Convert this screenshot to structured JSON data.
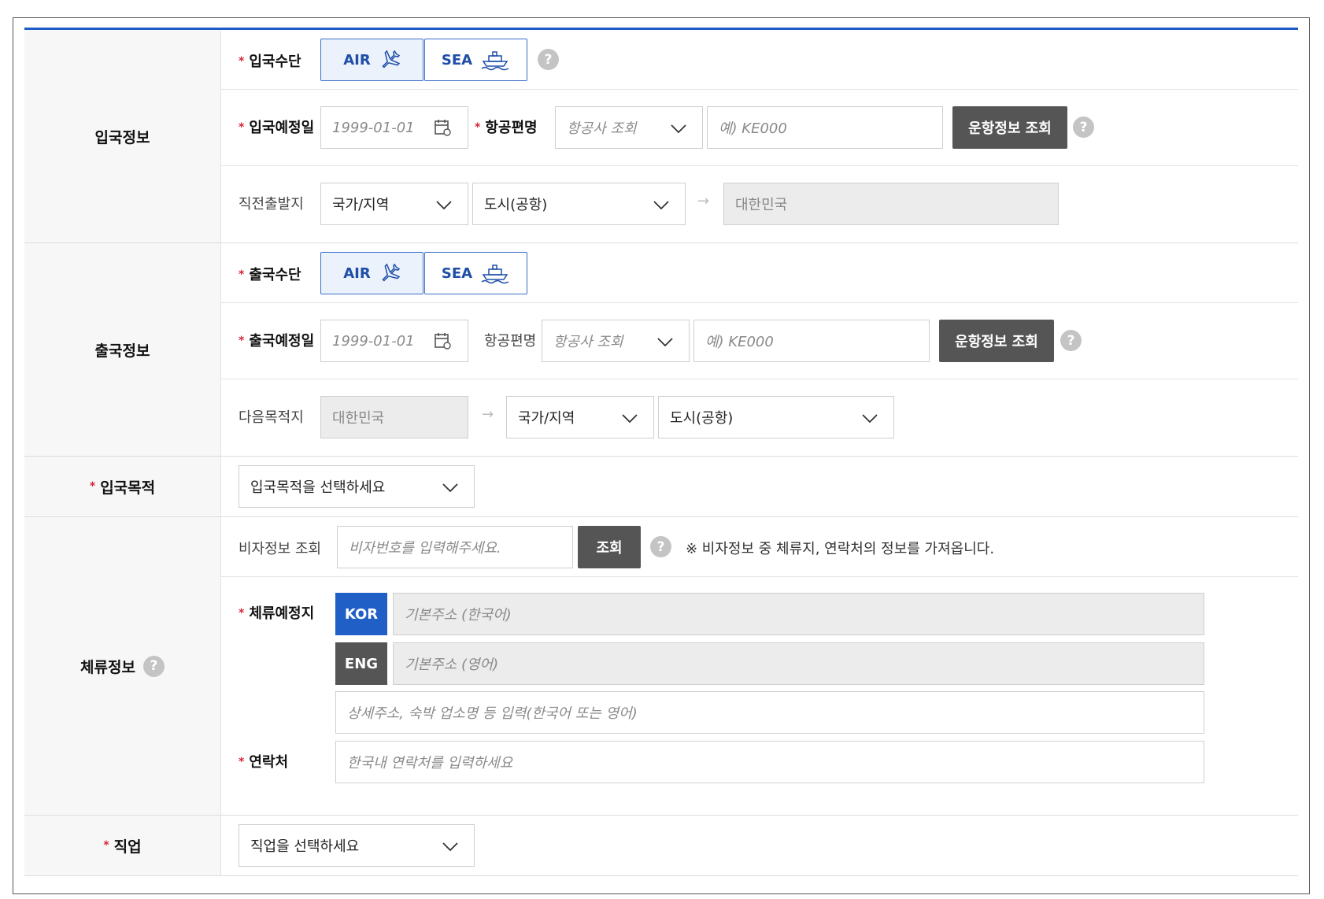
{
  "entry": {
    "section_label": "입국정보",
    "mode_label": "입국수단",
    "air": "AIR",
    "sea": "SEA",
    "date_label": "입국예정일",
    "date_value": "1999-01-01",
    "flight_label": "항공편명",
    "airline_placeholder": "항공사 조회",
    "flight_placeholder": "예) KE000",
    "lookup_button": "운항정보 조회",
    "origin_label": "직전출발지",
    "country_placeholder": "국가/지역",
    "city_placeholder": "도시(공항)",
    "destination_fixed": "대한민국"
  },
  "exit": {
    "section_label": "출국정보",
    "mode_label": "출국수단",
    "air": "AIR",
    "sea": "SEA",
    "date_label": "출국예정일",
    "date_value": "1999-01-01",
    "flight_label": "항공편명",
    "airline_placeholder": "항공사 조회",
    "flight_placeholder": "예) KE000",
    "lookup_button": "운항정보 조회",
    "next_label": "다음목적지",
    "origin_fixed": "대한민국",
    "country_placeholder": "국가/지역",
    "city_placeholder": "도시(공항)"
  },
  "purpose": {
    "label": "입국목적",
    "placeholder": "입국목적을 선택하세요"
  },
  "stay": {
    "section_label": "체류정보",
    "visa_label": "비자정보 조회",
    "visa_placeholder": "비자번호를 입력해주세요.",
    "visa_button": "조회",
    "visa_note": "※ 비자정보 중 체류지, 연락처의 정보를 가져옵니다.",
    "address_label": "체류예정지",
    "kor": "KOR",
    "eng": "ENG",
    "addr_kor_placeholder": "기본주소 (한국어)",
    "addr_eng_placeholder": "기본주소 (영어)",
    "addr_detail_placeholder": "상세주소, 숙박 업소명 등 입력(한국어 또는 영어)",
    "contact_label": "연락처",
    "contact_placeholder": "한국내 연락처를 입력하세요"
  },
  "job": {
    "label": "직업",
    "placeholder": "직업을 선택하세요"
  },
  "help_glyph": "?",
  "required_mark": "*",
  "arrow_glyph": "→",
  "colors": {
    "accent_blue": "#1e5bc6",
    "required_red": "#d6263a",
    "dark_button": "#555555"
  }
}
